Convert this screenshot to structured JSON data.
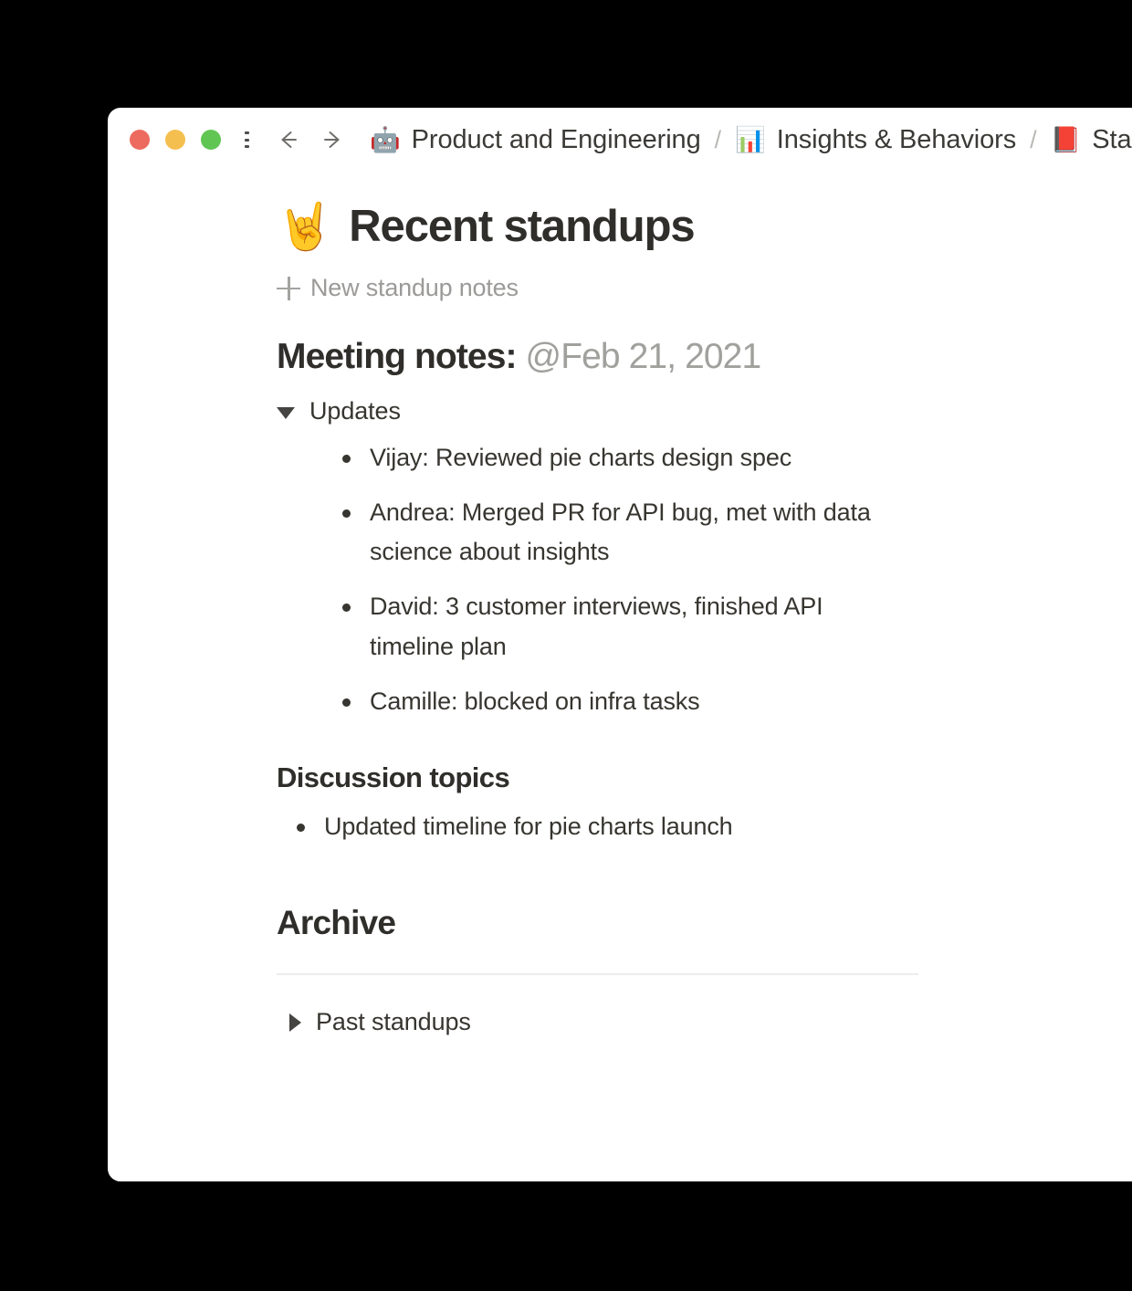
{
  "window": {
    "traffic_lights": [
      {
        "name": "close",
        "color": "#ED6A5E"
      },
      {
        "name": "minimize",
        "color": "#F5BF4F"
      },
      {
        "name": "maximize",
        "color": "#61C554"
      }
    ],
    "menu_icon": "hamburger-menu-icon",
    "back_icon": "arrow-left-icon",
    "forward_icon": "arrow-right-icon"
  },
  "breadcrumb": {
    "separator": "/",
    "items": [
      {
        "emoji": "🤖",
        "emoji_name": "robot-emoji",
        "label": "Product and Engineering"
      },
      {
        "emoji": "📊",
        "emoji_name": "bar-chart-emoji",
        "label": "Insights & Behaviors"
      },
      {
        "emoji": "📕",
        "emoji_name": "closed-book-emoji",
        "label": "Standups"
      }
    ]
  },
  "doc": {
    "emoji": "🤘",
    "emoji_name": "sign-of-the-horns-emoji",
    "title": "Recent standups",
    "new_page": {
      "icon": "plus-icon",
      "label": "New standup notes"
    },
    "meeting_notes": {
      "lead": "Meeting notes:",
      "date": "@Feb 21, 2021"
    },
    "updates": {
      "toggle_state": "expanded",
      "toggle_icon": "triangle-down-icon",
      "label": "Updates",
      "items": [
        "Vijay: Reviewed pie charts design spec",
        "Andrea: Merged PR for API bug, met with data science about insights",
        "David: 3 customer interviews, finished API timeline plan",
        "Camille: blocked on infra tasks"
      ]
    },
    "discussion": {
      "heading": "Discussion topics",
      "items": [
        "Updated timeline for pie charts launch"
      ]
    },
    "archive": {
      "heading": "Archive",
      "past": {
        "toggle_state": "collapsed",
        "toggle_icon": "triangle-right-icon",
        "label": "Past standups"
      }
    }
  },
  "colors": {
    "text": "#37352F",
    "muted": "#9B9A98",
    "divider": "#ECECEB",
    "window_bg": "#FFFFFF",
    "backdrop": "#000000"
  }
}
